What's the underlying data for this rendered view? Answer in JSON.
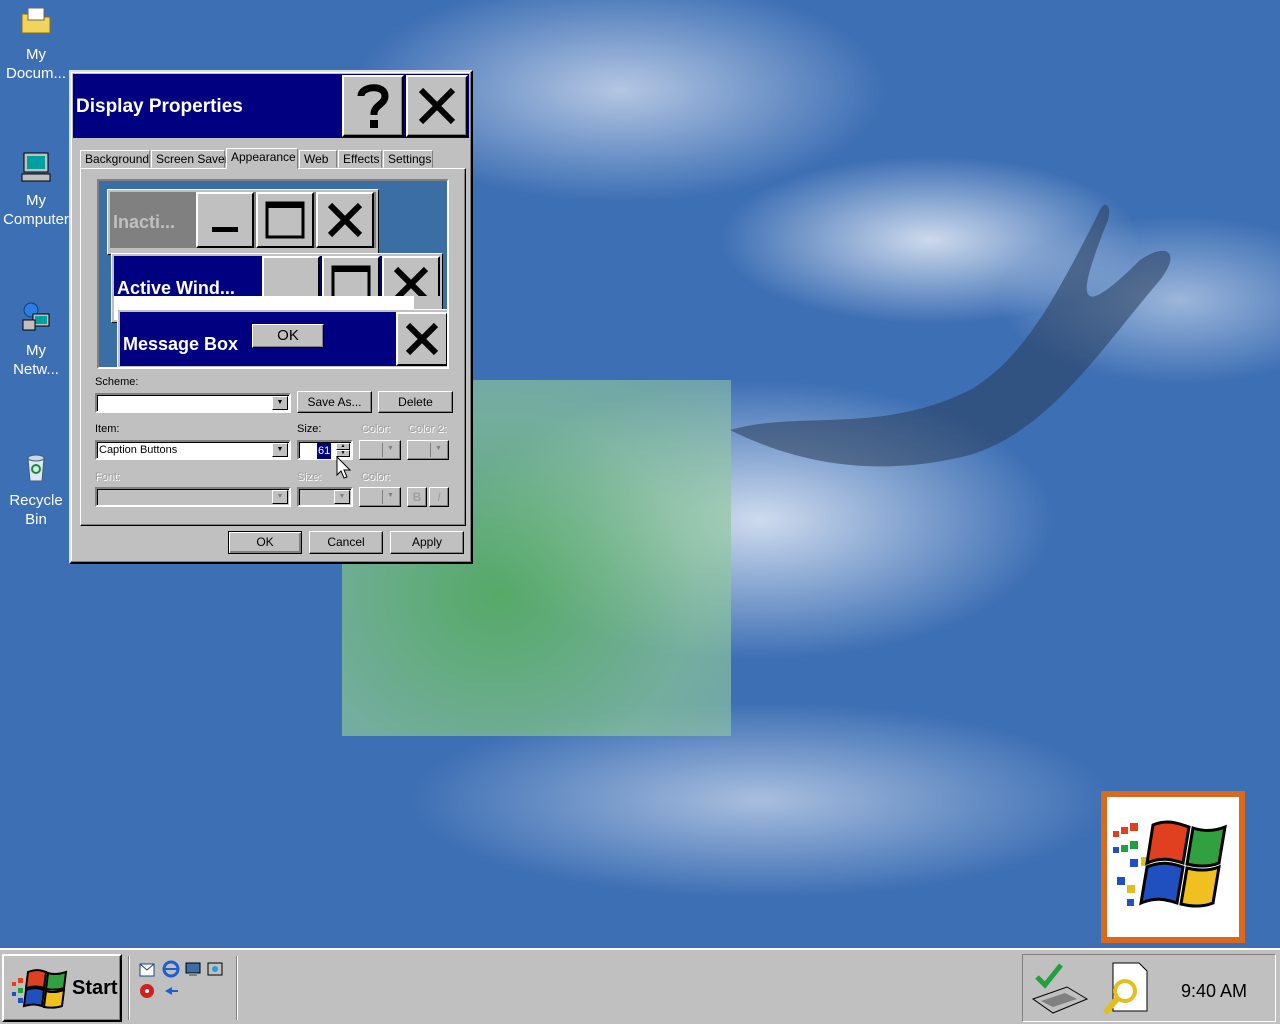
{
  "desktop": {
    "icons": [
      {
        "label": "My\nDocum...",
        "icon": "folder-icon"
      },
      {
        "label": "My\nComputer",
        "icon": "computer-icon"
      },
      {
        "label": "My\nNetw...",
        "icon": "network-icon"
      },
      {
        "label": "Recycle\nBin",
        "icon": "recycle-bin-icon"
      }
    ]
  },
  "dialog": {
    "title": "Display Properties",
    "help_icon": "question-mark-icon",
    "close_icon": "close-icon",
    "tabs": [
      "Background",
      "Screen Saver",
      "Appearance",
      "Web",
      "Effects",
      "Settings"
    ],
    "active_tab": "Appearance",
    "preview": {
      "inactive_title": "Inacti...",
      "active_title": "Active Wind...",
      "message_title": "Message Box",
      "ok_label": "OK"
    },
    "scheme_label": "Scheme:",
    "scheme_value": "",
    "save_as_label": "Save As...",
    "delete_label": "Delete",
    "item_label": "Item:",
    "item_value": "Caption Buttons",
    "size_label": "Size:",
    "size_value": "61",
    "color_label": "Color:",
    "color2_label": "Color 2:",
    "font_label": "Font:",
    "font_size_label": "Size:",
    "font_color_label": "Color:",
    "bold_label": "B",
    "italic_label": "I",
    "ok_label": "OK",
    "cancel_label": "Cancel",
    "apply_label": "Apply"
  },
  "taskbar": {
    "start_label": "Start",
    "clock": "9:40 AM"
  },
  "colors": {
    "title_active": "#000080",
    "inactive_title": "#808080",
    "desktop": "#3d6fb4",
    "face": "#c0c0c0"
  }
}
